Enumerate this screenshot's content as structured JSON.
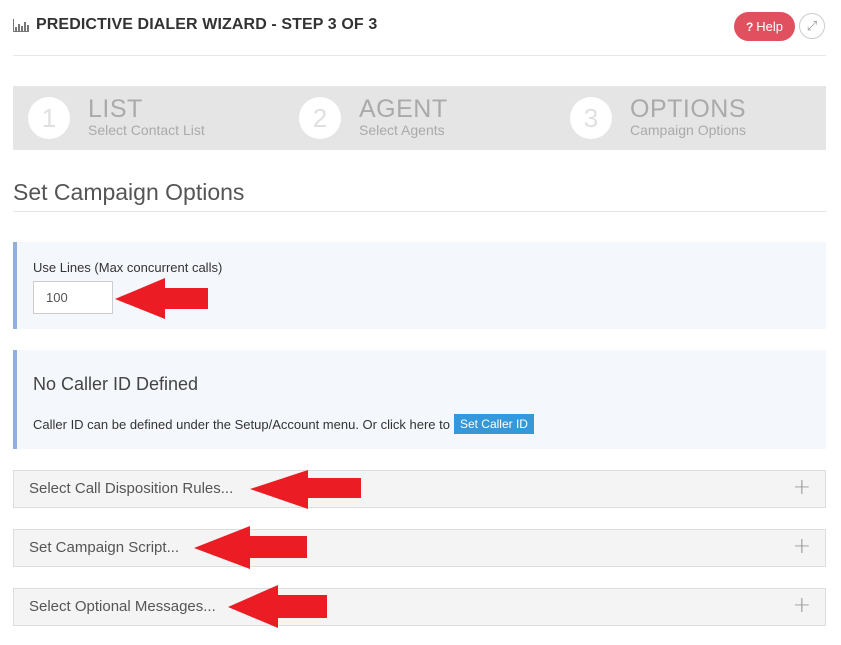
{
  "header": {
    "icon": "bar-chart-icon",
    "title": "PREDICTIVE DIALER WIZARD - STEP 3 OF 3",
    "help_label": "Help",
    "help_icon_glyph": "?",
    "expand_icon_glyph": "⤢"
  },
  "wizard": {
    "steps": [
      {
        "number": "1",
        "title": "LIST",
        "subtitle": "Select Contact List"
      },
      {
        "number": "2",
        "title": "AGENT",
        "subtitle": "Select Agents"
      },
      {
        "number": "3",
        "title": "OPTIONS",
        "subtitle": "Campaign Options"
      }
    ],
    "current_step": 3
  },
  "section": {
    "title": "Set Campaign Options"
  },
  "lines_panel": {
    "label": "Use Lines (Max concurrent calls)",
    "value": "100"
  },
  "caller_id_panel": {
    "heading": "No Caller ID Defined",
    "text": "Caller ID can be defined under the Setup/Account menu. Or click here to",
    "button_label": "Set Caller ID"
  },
  "accordions": [
    {
      "label": "Select Call Disposition Rules...",
      "icon": "+"
    },
    {
      "label": "Set Campaign Script...",
      "icon": "+"
    },
    {
      "label": "Select Optional Messages...",
      "icon": "+"
    }
  ],
  "colors": {
    "help": "#e0505f",
    "accent_blue": "#3498db",
    "panel_border": "#8fb0d8",
    "annotation_arrow": "#ec1c24"
  }
}
